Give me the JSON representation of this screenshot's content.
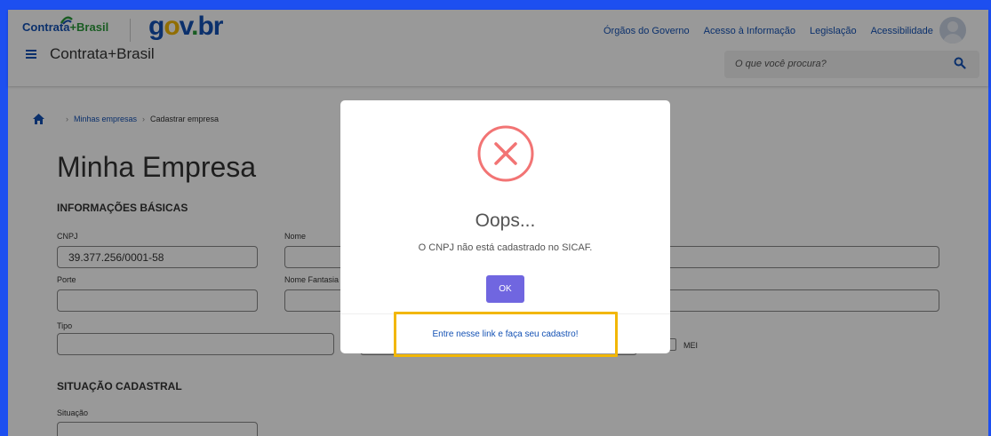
{
  "header": {
    "logo_contrata": "Contrata",
    "logo_plus": "+",
    "logo_brasil": "Brasil",
    "logo_govbr_g": "g",
    "logo_govbr_o": "o",
    "logo_govbr_v": "v",
    "logo_govbr_dot": ".",
    "logo_govbr_br": "br",
    "top_links": [
      "Órgãos do Governo",
      "Acesso à Informação",
      "Legislação",
      "Acessibilidade"
    ],
    "site_title": "Contrata+Brasil",
    "search_placeholder": "O que você procura?"
  },
  "breadcrumb": {
    "items": [
      "Minhas empresas",
      "Cadastrar empresa"
    ]
  },
  "page": {
    "title": "Minha Empresa",
    "section_basic": "INFORMAÇÕES BÁSICAS",
    "label_cnpj": "CNPJ",
    "value_cnpj": "39.377.256/0001-58",
    "label_nome": "Nome",
    "label_porte": "Porte",
    "label_nome_fantasia": "Nome Fantasia",
    "label_tipo": "Tipo",
    "label_mei": "MEI",
    "section_situacao": "SITUAÇÃO CADASTRAL",
    "label_situacao": "Situação"
  },
  "modal": {
    "title": "Oops...",
    "message": "O CNPJ não está cadastrado no SICAF.",
    "ok_label": "OK",
    "footer_link": "Entre nesse link e faça seu cadastro!"
  },
  "colors": {
    "brand_blue": "#1351b4",
    "frame_blue": "#1d4ff0",
    "error_red": "#f27474",
    "ok_purple": "#7066e0",
    "highlight_yellow": "#f2b705"
  }
}
